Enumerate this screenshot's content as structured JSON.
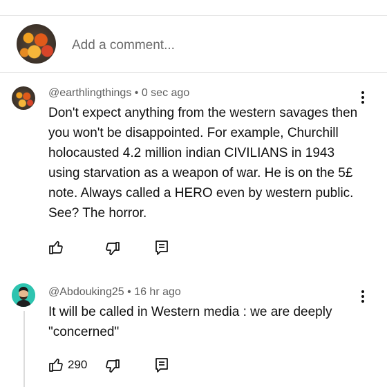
{
  "composer": {
    "placeholder": "Add a comment...",
    "avatar_icon": "flowers-avatar-icon"
  },
  "comments": [
    {
      "handle": "@earthlingthings",
      "separator": "•",
      "time": "0 sec ago",
      "text": "Don't expect anything from the western savages then you won't be disappointed. For example, Churchill holocausted 4.2 million indian CIVILIANS in 1943 using starvation as a weapon of war. He is on the 5£ note. Always called a HERO even by western public. See? The horror.",
      "like_count": "",
      "icons": [
        "thumbs-up-icon",
        "thumbs-down-icon",
        "reply-icon",
        "more-options-icon"
      ]
    },
    {
      "handle": "@Abdouking25",
      "separator": "•",
      "time": "16 hr ago",
      "text": "It will be called in Western media : we are deeply \"concerned\"",
      "like_count": "290",
      "icons": [
        "thumbs-up-icon",
        "thumbs-down-icon",
        "reply-icon",
        "more-options-icon"
      ]
    }
  ],
  "colors": {
    "text": "#0f0f0f",
    "secondary_text": "#606060",
    "divider": "#dcdcdc",
    "avatar_accent": "#2ec4b0"
  }
}
